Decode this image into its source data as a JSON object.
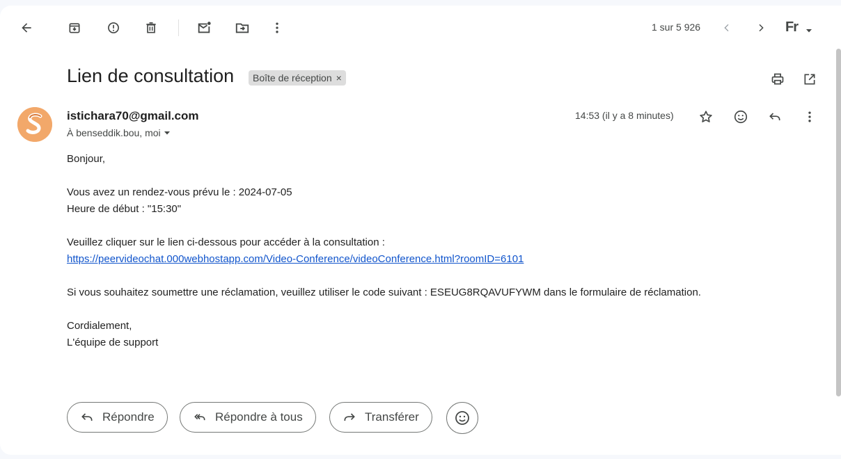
{
  "toolbar": {
    "back_icon": "arrow-left-icon",
    "archive_icon": "archive-icon",
    "spam_icon": "report-spam-icon",
    "delete_icon": "trash-icon",
    "mark_unread_icon": "mark-unread-icon",
    "move_icon": "move-to-icon",
    "more_icon": "more-vert-icon",
    "pagination": "1 sur 5 926",
    "prev_icon": "chevron-left-icon",
    "next_icon": "chevron-right-icon",
    "input_tool": "Fr"
  },
  "message": {
    "subject": "Lien de consultation",
    "label": "Boîte de réception",
    "label_remove": "×",
    "sender": "istichara70@gmail.com",
    "recipients": "À benseddik.bou, moi",
    "time": "14:53 (il y a 8 minutes)",
    "body": {
      "greeting": "Bonjour,",
      "line1": "Vous avez un rendez-vous prévu le : 2024-07-05",
      "line2": "Heure de début : \"15:30\"",
      "line3": "Veuillez cliquer sur le lien ci-dessous pour accéder à la consultation :",
      "link": "https://peervideochat.000webhostapp.com/Video-Conference/videoConference.html?roomID=6101",
      "line4": "Si vous souhaitez soumettre une réclamation, veuillez utiliser le code suivant : ESEUG8RQAVUFYWM dans le formulaire de réclamation.",
      "closing": "Cordialement,",
      "signature": "L'équipe de support"
    }
  },
  "actions": {
    "reply": "Répondre",
    "reply_all": "Répondre à tous",
    "forward": "Transférer"
  },
  "colors": {
    "avatar": "#f2a86a",
    "link": "#1155cc",
    "label_chip": "#dddddd"
  }
}
